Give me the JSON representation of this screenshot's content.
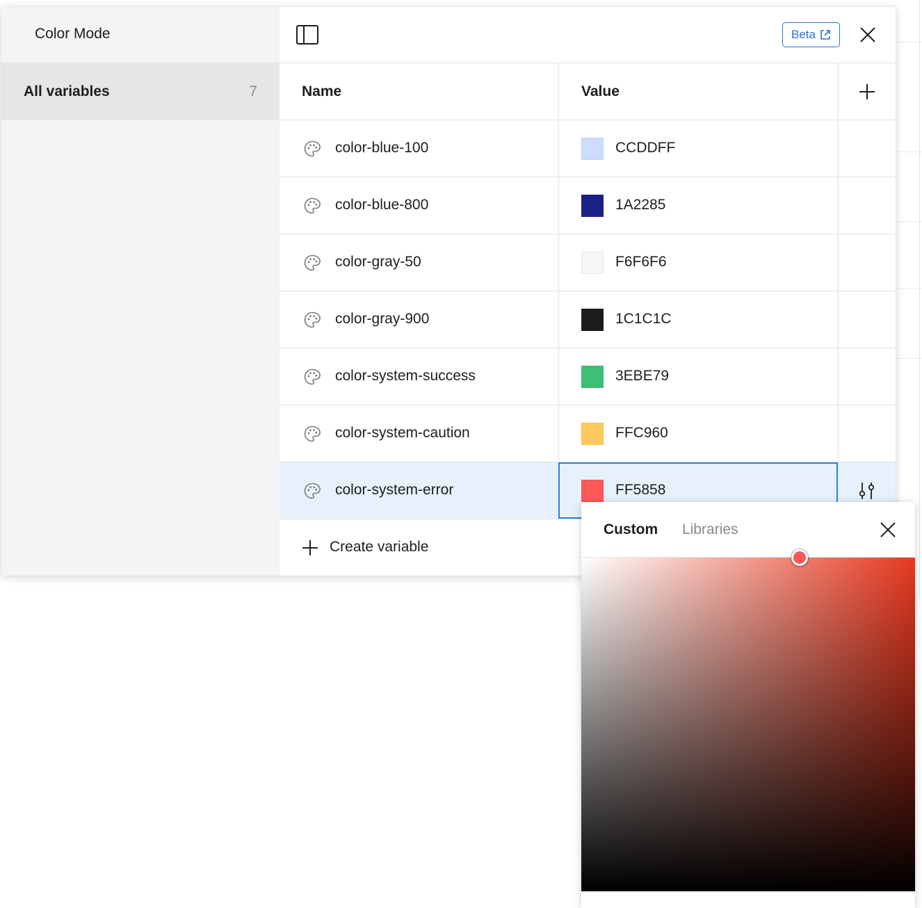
{
  "sidebar": {
    "title": "Color Mode",
    "items": [
      {
        "label": "All variables",
        "count": "7"
      }
    ]
  },
  "toolbar": {
    "beta_label": "Beta"
  },
  "table": {
    "headers": {
      "name": "Name",
      "value": "Value"
    },
    "rows": [
      {
        "name": "color-blue-100",
        "value": "CCDDFF",
        "color": "#CCDDFF"
      },
      {
        "name": "color-blue-800",
        "value": "1A2285",
        "color": "#1A2285"
      },
      {
        "name": "color-gray-50",
        "value": "F6F6F6",
        "color": "#F6F6F6"
      },
      {
        "name": "color-gray-900",
        "value": "1C1C1C",
        "color": "#1C1C1C"
      },
      {
        "name": "color-system-success",
        "value": "3EBE79",
        "color": "#3EBE79"
      },
      {
        "name": "color-system-caution",
        "value": "FFC960",
        "color": "#FFC960"
      },
      {
        "name": "color-system-error",
        "value": "FF5858",
        "color": "#FF5858",
        "selected": true
      }
    ],
    "create_label": "Create variable"
  },
  "picker": {
    "tabs": [
      "Custom",
      "Libraries"
    ],
    "active_tab": "Custom",
    "hue_color": "#E8391F",
    "selected_color": "#FF5858"
  },
  "colors": {
    "accent": "#2F6ECF",
    "selection_bg": "#E6F1FB"
  }
}
